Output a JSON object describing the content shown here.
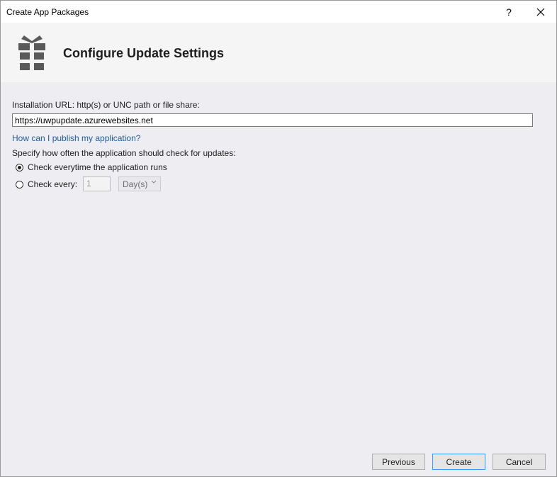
{
  "window": {
    "title": "Create App Packages",
    "help_label": "?"
  },
  "banner": {
    "icon": "gift-box-icon",
    "title": "Configure Update Settings"
  },
  "form": {
    "url_label": "Installation URL: http(s) or UNC path or file share:",
    "url_value": "https://uwpupdate.azurewebsites.net",
    "publish_link": "How can I publish my application?",
    "frequency_label": "Specify how often the application should check for updates:",
    "options": [
      {
        "label": "Check everytime the application runs",
        "checked": true
      },
      {
        "label": "Check every:",
        "checked": false
      }
    ],
    "interval_value": "1",
    "interval_unit": "Day(s)"
  },
  "footer": {
    "previous_label": "Previous",
    "create_label": "Create",
    "cancel_label": "Cancel"
  }
}
